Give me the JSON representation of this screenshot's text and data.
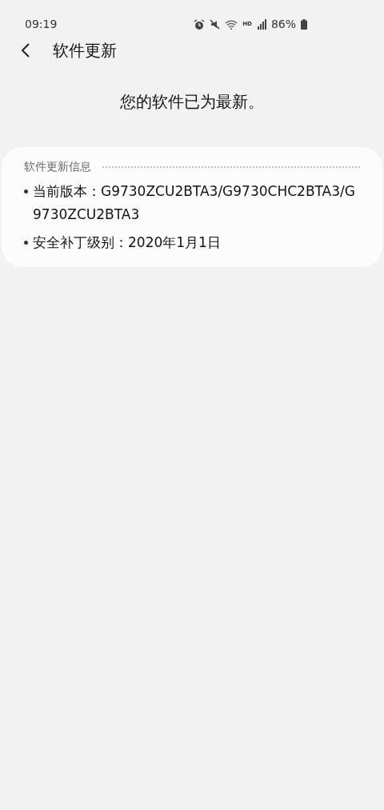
{
  "status_bar": {
    "time": "09:19",
    "network_label": "HD",
    "battery": "86%"
  },
  "header": {
    "title": "软件更新"
  },
  "message": "您的软件已为最新。",
  "info_card": {
    "title": "软件更新信息",
    "items": [
      {
        "label": "当前版本：",
        "value": "G9730ZCU2BTA3/G9730CHC2BTA3/G9730ZCU2BTA3"
      },
      {
        "label": "安全补丁级别：",
        "value": "2020年1月1日"
      }
    ]
  }
}
